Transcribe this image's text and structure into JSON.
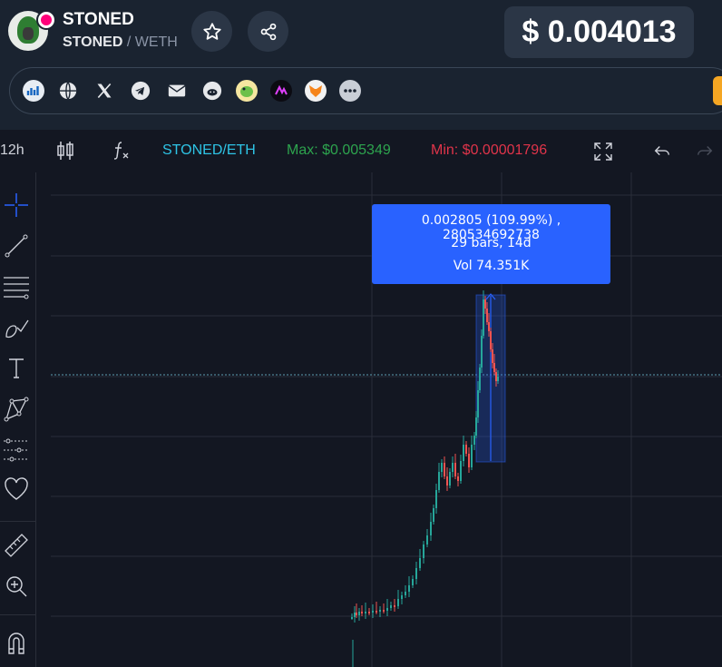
{
  "token": {
    "name": "STONED",
    "base": "STONED",
    "separator": "/",
    "quote": "WETH"
  },
  "price": "$ 0.004013",
  "social_links": [
    "dextools-icon",
    "globe-icon",
    "x-icon",
    "telegram-icon",
    "email-icon",
    "reddit-icon",
    "dex-frog-icon",
    "audit-icon",
    "metamask-icon",
    "more-icon"
  ],
  "toolbar": {
    "interval": "12h",
    "pair": "STONED/ETH",
    "max": "Max: $0.005349",
    "min": "Min: $0.00001796"
  },
  "measure_tooltip": {
    "line1": "0.002805 (109.99%) , 280534692738",
    "line2": "29 bars, 14d",
    "line3": "Vol 74.351K"
  },
  "colors": {
    "up": "#26a69a",
    "down": "#ef5350",
    "accent": "#2962ff",
    "max": "#2da44e",
    "min": "#e0344a"
  }
}
